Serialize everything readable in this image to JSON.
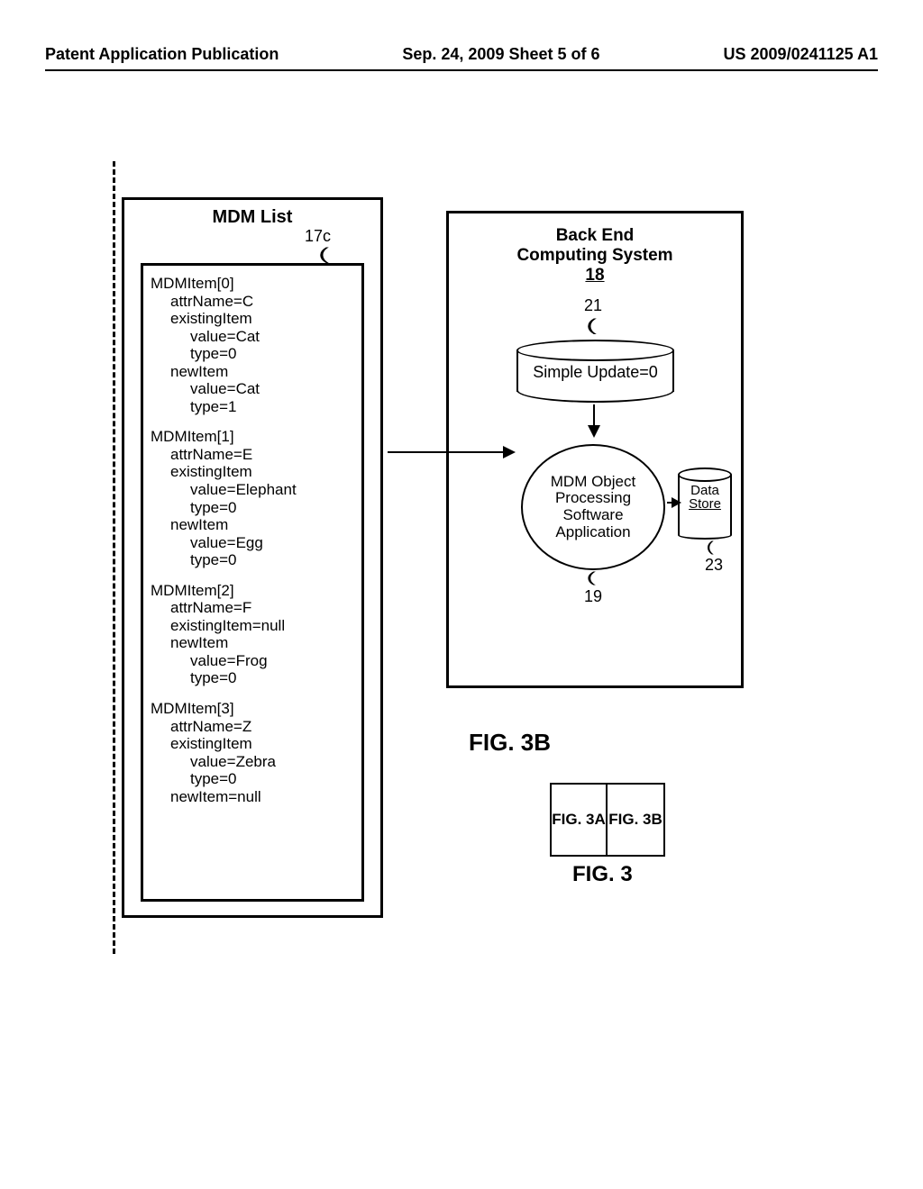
{
  "header": {
    "left": "Patent Application Publication",
    "mid": "Sep. 24, 2009  Sheet 5 of 6",
    "right": "US 2009/0241125 A1"
  },
  "mdm": {
    "title": "MDM List",
    "ref": "17c",
    "items": [
      {
        "head": "MDMItem[0]",
        "attr": "attrName=C",
        "existingLabel": "existingItem",
        "existingValue": "value=Cat",
        "existingType": "type=0",
        "newLabel": "newItem",
        "newValue": "value=Cat",
        "newType": "type=1"
      },
      {
        "head": "MDMItem[1]",
        "attr": "attrName=E",
        "existingLabel": "existingItem",
        "existingValue": "value=Elephant",
        "existingType": "type=0",
        "newLabel": "newItem",
        "newValue": "value=Egg",
        "newType": "type=0"
      },
      {
        "head": "MDMItem[2]",
        "attr": "attrName=F",
        "existingLabel": "existingItem=null",
        "existingValue": "",
        "existingType": "",
        "newLabel": "newItem",
        "newValue": "value=Frog",
        "newType": "type=0"
      },
      {
        "head": "MDMItem[3]",
        "attr": "attrName=Z",
        "existingLabel": "existingItem",
        "existingValue": "value=Zebra",
        "existingType": "type=0",
        "newLabel": "newItem=null",
        "newValue": "",
        "newType": ""
      }
    ]
  },
  "backend": {
    "title_l1": "Back End",
    "title_l2": "Computing System",
    "id": "18",
    "ref21": "21",
    "cyl21_label": "Simple  Update=0",
    "oval19": "MDM  Object Processing Software Application",
    "ref19": "19",
    "ds_l1": "Data",
    "ds_l2": "Store",
    "ref23": "23"
  },
  "figs": {
    "fig3b": "FIG. 3B",
    "cell_a": "FIG. 3A",
    "cell_b": "FIG. 3B",
    "fig3": "FIG. 3"
  }
}
